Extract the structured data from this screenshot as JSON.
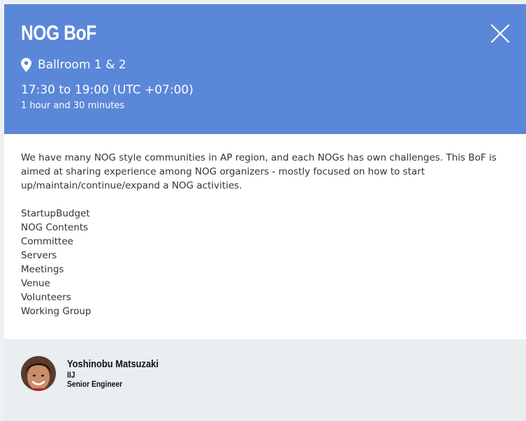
{
  "session": {
    "title": "NOG BoF",
    "location": "Ballroom 1 & 2",
    "time": "17:30 to 19:00 (UTC +07:00)",
    "duration": "1 hour and 30 minutes"
  },
  "description": "We have many NOG style communities in AP region, and each NOGs has own challenges. This BoF is aimed at sharing experience among NOG organizers - mostly focused on how to start up/maintain/continue/expand a NOG activities.",
  "topics": [
    "StartupBudget",
    "NOG Contents",
    "Committee",
    "Servers",
    "Meetings",
    "Venue",
    "Volunteers",
    "Working Group"
  ],
  "speaker": {
    "name": "Yoshinobu Matsuzaki",
    "organization": "IIJ",
    "role": "Senior Engineer"
  },
  "icons": {
    "close": "close-icon",
    "location": "map-pin-icon",
    "avatar": "speaker-avatar"
  },
  "colors": {
    "header_background": "#5b87d8",
    "header_text": "#ffffff",
    "body_text": "#333333",
    "footer_background": "#e9eef0",
    "page_background": "#eef1f2"
  }
}
